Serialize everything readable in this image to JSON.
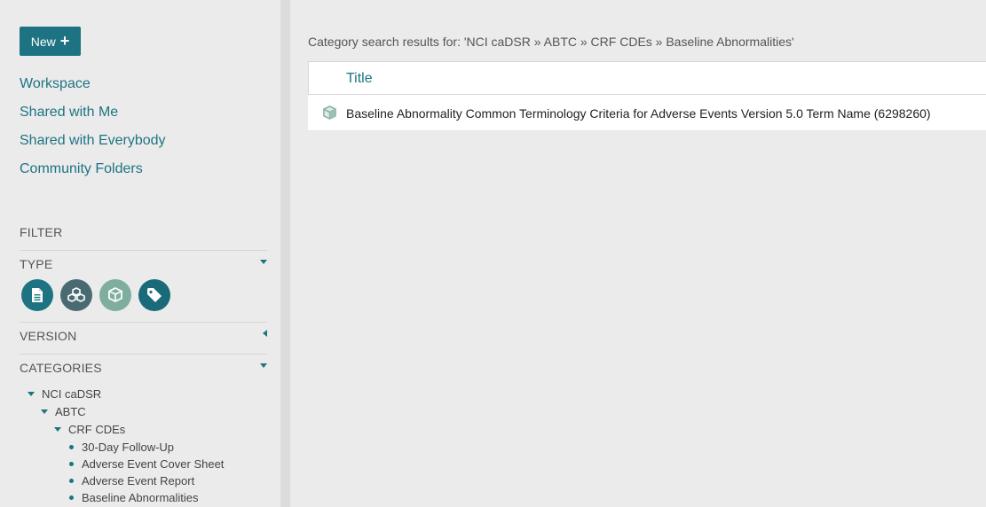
{
  "sidebar": {
    "new_button": "New",
    "nav": [
      "Workspace",
      "Shared with Me",
      "Shared with Everybody",
      "Community Folders"
    ],
    "filter_label": "FILTER",
    "type_label": "TYPE",
    "type_icons": [
      "template-element-icon",
      "template-icon",
      "field-icon",
      "tag-icon"
    ],
    "version_label": "VERSION",
    "categories_label": "CATEGORIES",
    "tree": {
      "root": "NCI caDSR",
      "child": "ABTC",
      "grandchild": "CRF CDEs",
      "leaves": [
        "30-Day Follow-Up",
        "Adverse Event Cover Sheet",
        "Adverse Event Report",
        "Baseline Abnormalities"
      ]
    }
  },
  "main": {
    "heading": "Category search results for: 'NCI caDSR » ABTC » CRF CDEs » Baseline Abnormalities'",
    "table_header": "Title",
    "rows": [
      {
        "title": "Baseline Abnormality Common Terminology Criteria for Adverse Events Version 5.0 Term Name (6298260)",
        "icon": "field-icon"
      }
    ]
  },
  "colors": {
    "accent": "#1e7383",
    "type_template_element": "#1e7383",
    "type_template": "#4a6a72",
    "type_field": "#7fae9e",
    "type_tag": "#1a6a7a"
  }
}
